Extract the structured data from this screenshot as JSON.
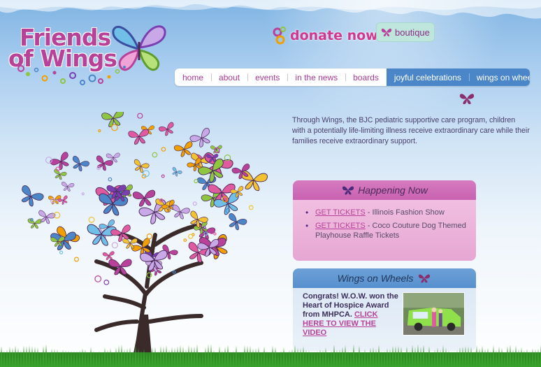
{
  "logo": {
    "line1": "Friends",
    "line2": "of Wings"
  },
  "header": {
    "donate_label": "donate now!",
    "boutique_label": "boutique"
  },
  "nav": {
    "items": [
      {
        "label": "home"
      },
      {
        "label": "about"
      },
      {
        "label": "events"
      },
      {
        "label": "in the news"
      },
      {
        "label": "boards"
      },
      {
        "label": "joyful celebrations"
      },
      {
        "label": "wings on wheels"
      }
    ]
  },
  "intro": {
    "text": "Through Wings, the BJC pediatric supportive care program, children with a potentially life-limiting illness receive extraordinary care while their families receive extraordinary support."
  },
  "happening_now": {
    "title": "Happening Now",
    "items": [
      {
        "link": "GET TICKETS",
        "text": " - Illinois Fashion Show"
      },
      {
        "link": "GET TICKETS",
        "text": " - Coco Couture Dog Themed Playhouse Raffle Tickets"
      }
    ]
  },
  "wings_on_wheels": {
    "title": "Wings on Wheels",
    "text": "Congrats! W.O.W. won the Heart of Hospice Award from MHPCA. ",
    "link": "CLICK HERE TO VIEW THE VIDEO"
  },
  "colors": {
    "brand_pink": "#b8429a",
    "nav_blue": "#4a86c8",
    "happening_head": "#c861b1",
    "wheels_head": "#5790cf"
  },
  "icons": [
    "butterfly-icon",
    "donate-rings-icon"
  ]
}
